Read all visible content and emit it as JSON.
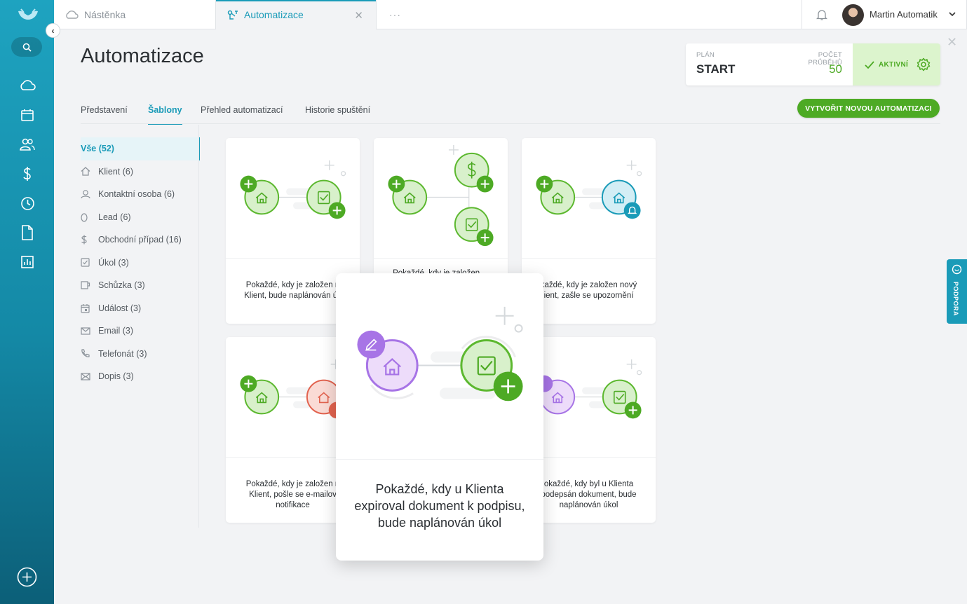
{
  "topbar": {
    "tab_dashboard": "Nástěnka",
    "tab_automation": "Automatizace",
    "tab_more": "···",
    "close_tab": "✕",
    "user_name": "Martin Automatik"
  },
  "page": {
    "title": "Automatizace",
    "close": "✕"
  },
  "plan": {
    "plan_label": "PLÁN",
    "plan_value": "START",
    "runs_label": "POČET PRŮBĚHŮ",
    "runs_value": "50",
    "status": "AKTIVNÍ"
  },
  "subtabs": [
    {
      "label": "Představení"
    },
    {
      "label": "Šablony"
    },
    {
      "label": "Přehled automatizací"
    },
    {
      "label": "Historie spuštění"
    }
  ],
  "new_button": "VYTVOŘIT NOVOU AUTOMATIZACI",
  "filters": [
    {
      "label": "Vše (52)",
      "icon": "none"
    },
    {
      "label": "Klient (6)",
      "icon": "home-icon"
    },
    {
      "label": "Kontaktní osoba (6)",
      "icon": "person-icon"
    },
    {
      "label": "Lead (6)",
      "icon": "egg-icon"
    },
    {
      "label": "Obchodní případ (16)",
      "icon": "dollar-icon"
    },
    {
      "label": "Úkol (3)",
      "icon": "task-icon"
    },
    {
      "label": "Schůzka (3)",
      "icon": "cup-icon"
    },
    {
      "label": "Událost (3)",
      "icon": "calendar-icon"
    },
    {
      "label": "Email (3)",
      "icon": "mail-icon"
    },
    {
      "label": "Telefonát (3)",
      "icon": "phone-icon"
    },
    {
      "label": "Dopis (3)",
      "icon": "letter-icon"
    }
  ],
  "cards": [
    {
      "text": "Pokaždé, kdy je založen n\nKlient, bude naplánován úk"
    },
    {
      "text": "Pokaždé, kdy je založen ..."
    },
    {
      "text": "každé, kdy je založen nový\nient, zašle se upozornění"
    },
    {
      "text": "Pokaždé, kdy je založen n\nKlient, pošle se e-mailov\nnotifikace"
    },
    {
      "text": "okaždé, kdy byl u Klienta\npodepsán dokument, bude\nnaplánován úkol"
    }
  ],
  "featured_card": {
    "text": "Pokaždé, kdy u Klienta expiroval dokument k podpisu, bude naplánován úkol"
  },
  "support_label": "PODPORA",
  "colors": {
    "accent": "#1a9bb8",
    "green": "#4daa24",
    "purple": "#a774e6",
    "red": "#e2634f"
  }
}
